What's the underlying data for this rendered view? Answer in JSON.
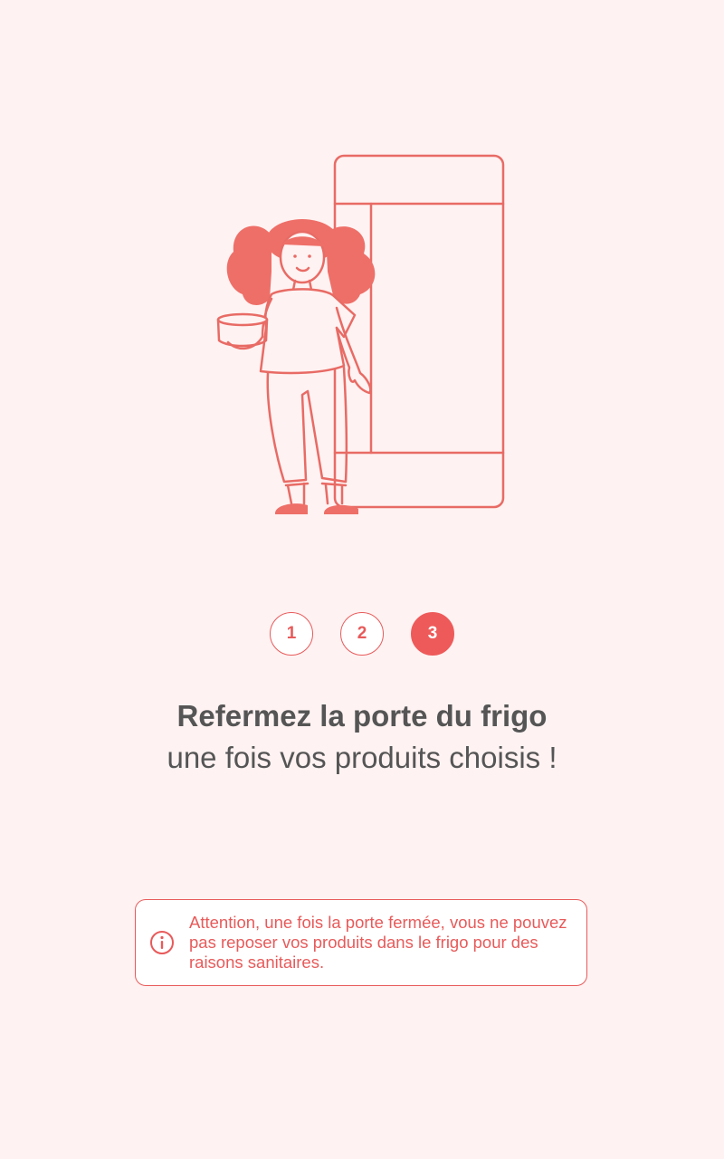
{
  "illustration": {
    "icon": "woman-holding-product-at-fridge",
    "color": "#E86B65"
  },
  "steps": [
    {
      "label": "1",
      "active": false
    },
    {
      "label": "2",
      "active": false
    },
    {
      "label": "3",
      "active": true
    }
  ],
  "title": "Refermez la porte du frigo",
  "subtitle": "une fois vos produits choisis !",
  "notice": {
    "icon": "info-icon",
    "text": "Attention, une fois la porte fermée, vous ne pouvez pas reposer vos produits dans le frigo pour des raisons sanitaires."
  },
  "colors": {
    "background": "#FFF2F2",
    "accent": "#EE5A5A",
    "text": "#555555"
  }
}
